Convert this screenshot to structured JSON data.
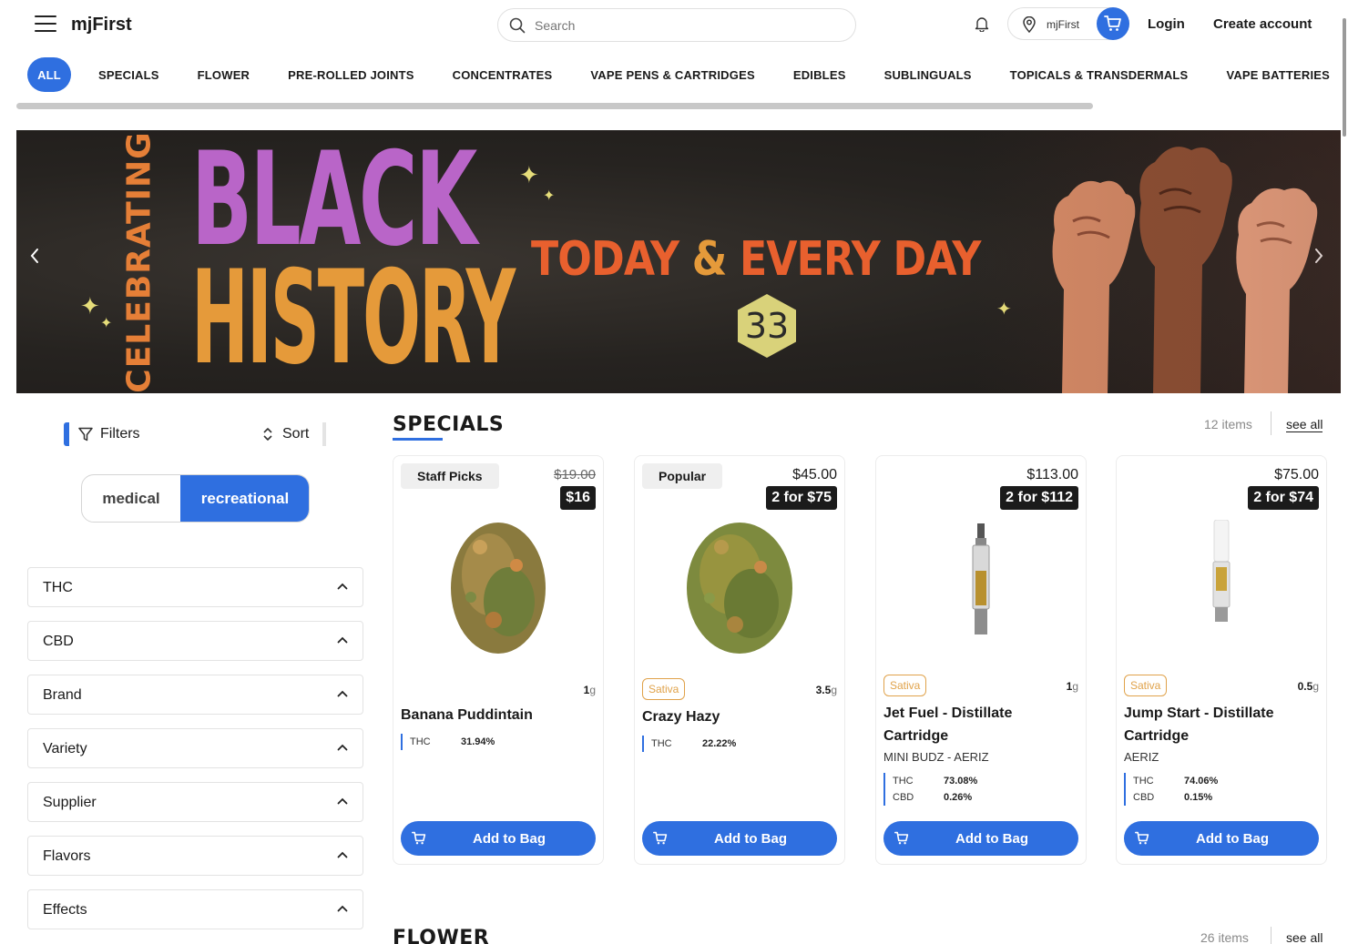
{
  "header": {
    "brand": "mjFirst",
    "search_placeholder": "Search",
    "location_label": "mjFirst",
    "login_label": "Login",
    "create_account_label": "Create account"
  },
  "categories": [
    "ALL",
    "SPECIALS",
    "FLOWER",
    "PRE-ROLLED JOINTS",
    "CONCENTRATES",
    "VAPE PENS & CARTRIDGES",
    "EDIBLES",
    "SUBLINGUALS",
    "TOPICALS & TRANSDERMALS",
    "VAPE BATTERIES"
  ],
  "banner": {
    "vertical_text": "CELEBRATING",
    "line1": "BLACK",
    "line2": "HISTORY",
    "tagline_left": "TODAY",
    "tagline_amp": "&",
    "tagline_right": "EVERY DAY",
    "hex_number": "33"
  },
  "sidebar": {
    "filters_label": "Filters",
    "sort_label": "Sort",
    "toggle": {
      "medical": "medical",
      "recreational": "recreational",
      "selected": "recreational"
    },
    "facets": [
      "THC",
      "CBD",
      "Brand",
      "Variety",
      "Supplier",
      "Flavors",
      "Effects"
    ]
  },
  "specials": {
    "title": "SPECIALS",
    "count": "12 items",
    "see_all": "see all",
    "products": [
      {
        "badge": "Staff Picks",
        "price_old": "$19.00",
        "deal": "$16",
        "strain": "",
        "weight": "1",
        "unit": "g",
        "name": "Banana Puddintain",
        "brand": "",
        "thc": "31.94%",
        "cbd": "",
        "add_label": "Add to Bag"
      },
      {
        "badge": "Popular",
        "price": "$45.00",
        "deal": "2 for $75",
        "strain": "Sativa",
        "weight": "3.5",
        "unit": "g",
        "name": "Crazy Hazy",
        "brand": "",
        "thc": "22.22%",
        "cbd": "",
        "add_label": "Add to Bag"
      },
      {
        "badge": "",
        "price": "$113.00",
        "deal": "2 for $112",
        "strain": "Sativa",
        "weight": "1",
        "unit": "g",
        "name": "Jet Fuel - Distillate Cartridge",
        "brand": "MINI BUDZ - AERIZ",
        "thc": "73.08%",
        "cbd": "0.26%",
        "add_label": "Add to Bag"
      },
      {
        "badge": "",
        "price": "$75.00",
        "deal": "2 for $74",
        "strain": "Sativa",
        "weight": "0.5",
        "unit": "g",
        "name": "Jump Start - Distillate Cartridge",
        "brand": "AERIZ",
        "thc": "74.06%",
        "cbd": "0.15%",
        "add_label": "Add to Bag"
      }
    ],
    "thc_label": "THC",
    "cbd_label": "CBD"
  },
  "flower": {
    "title": "FLOWER",
    "count": "26 items",
    "see_all": "see all"
  },
  "colors": {
    "accent": "#2f6fe0",
    "deal_bg": "#1b1b1b",
    "strain": "#e0a24a"
  }
}
